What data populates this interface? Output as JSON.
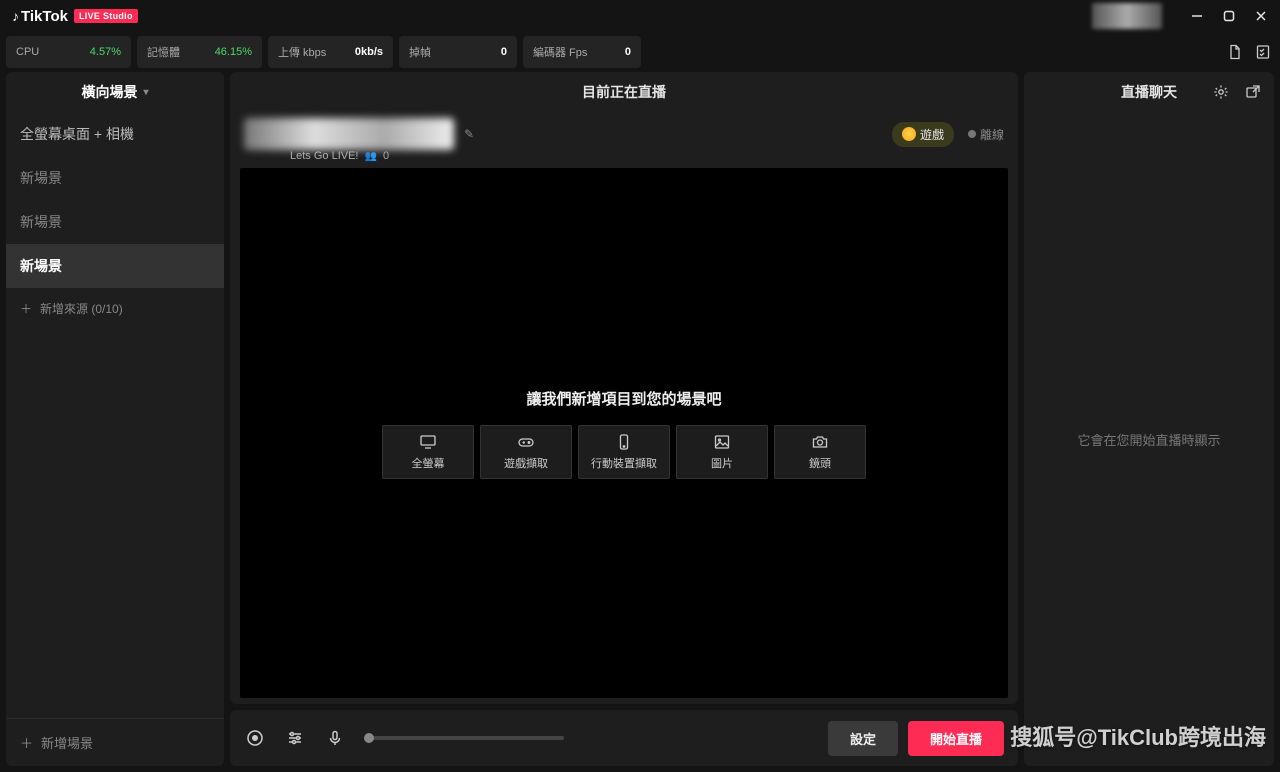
{
  "brand": {
    "name": "TikTok",
    "badge": "LIVE Studio"
  },
  "stats": {
    "cpu_label": "CPU",
    "cpu_value": "4.57%",
    "mem_label": "記憶體",
    "mem_value": "46.15%",
    "upload_label": "上傳 kbps",
    "upload_value": "0kb/s",
    "drop_label": "掉幀",
    "drop_value": "0",
    "enc_label": "編碼器 Fps",
    "enc_value": "0"
  },
  "sidebar": {
    "title": "橫向場景",
    "scenes": [
      {
        "label": "全螢幕桌面 + 相機",
        "active": false
      },
      {
        "label": "新場景",
        "active": false
      },
      {
        "label": "新場景",
        "active": false
      },
      {
        "label": "新場景",
        "active": true
      }
    ],
    "add_source": "新增來源 (0/10)",
    "add_scene": "新增場景"
  },
  "center": {
    "header": "目前正在直播",
    "subtitle": "Lets Go LIVE!",
    "viewers": "0",
    "game_label": "遊戲",
    "offline_label": "離線",
    "empty_title": "讓我們新增項目到您的場景吧",
    "tiles": [
      {
        "key": "fullscreen",
        "label": "全螢幕"
      },
      {
        "key": "game",
        "label": "遊戲擷取"
      },
      {
        "key": "mobile",
        "label": "行動裝置擷取"
      },
      {
        "key": "image",
        "label": "圖片"
      },
      {
        "key": "camera",
        "label": "鏡頭"
      }
    ],
    "settings_btn": "設定",
    "end_btn": "開始直播"
  },
  "chat": {
    "title": "直播聊天",
    "empty": "它會在您開始直播時顯示"
  },
  "watermark": "搜狐号@TikClub跨境出海"
}
